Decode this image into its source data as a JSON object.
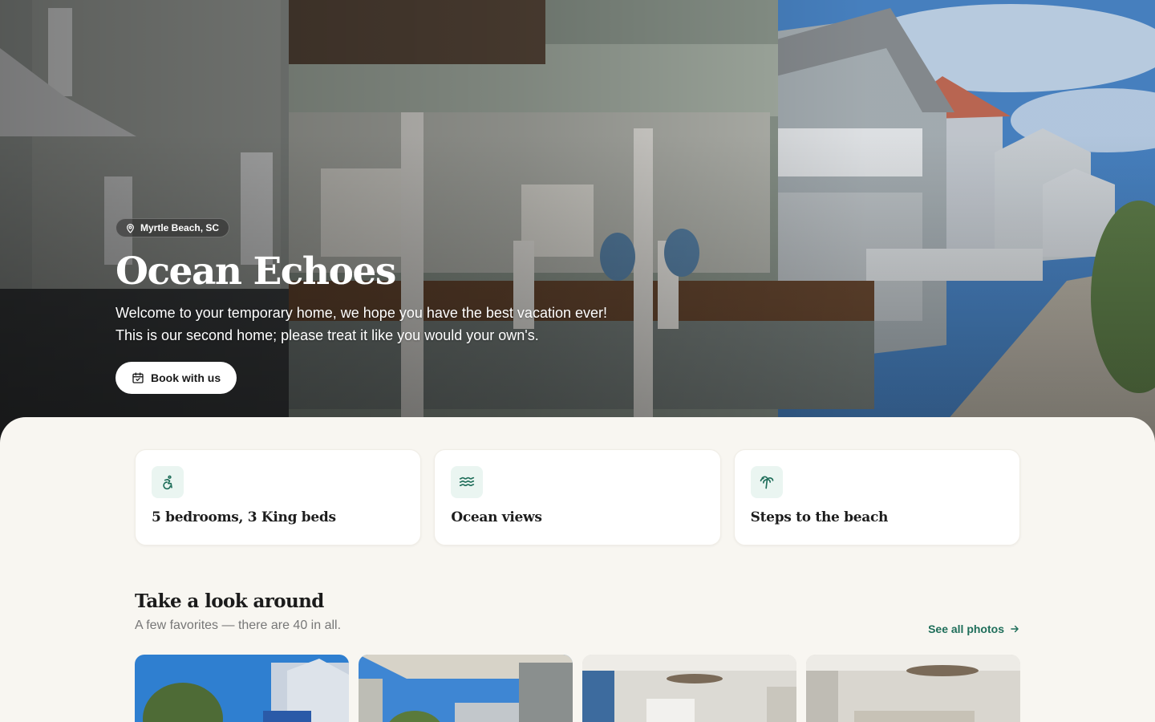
{
  "hero": {
    "location": "Myrtle Beach, SC",
    "title": "Ocean Echoes",
    "description_line1": "Welcome to your temporary home, we hope you have the best vacation ever!",
    "description_line2": "This is our second home; please treat it like you would your own's.",
    "book_label": "Book with us"
  },
  "features": [
    {
      "label": "5 bedrooms, 3 King beds",
      "icon": "accessibility-icon"
    },
    {
      "label": "Ocean views",
      "icon": "waves-icon"
    },
    {
      "label": "Steps to the beach",
      "icon": "palm-tree-icon"
    }
  ],
  "gallery": {
    "title": "Take a look around",
    "subtitle": "A few favorites — there are 40 in all.",
    "see_all_label": "See all photos"
  },
  "colors": {
    "accent": "#1f6e5a",
    "icon_bg": "#eaf5f1",
    "sheet_bg": "#f8f6f1"
  }
}
